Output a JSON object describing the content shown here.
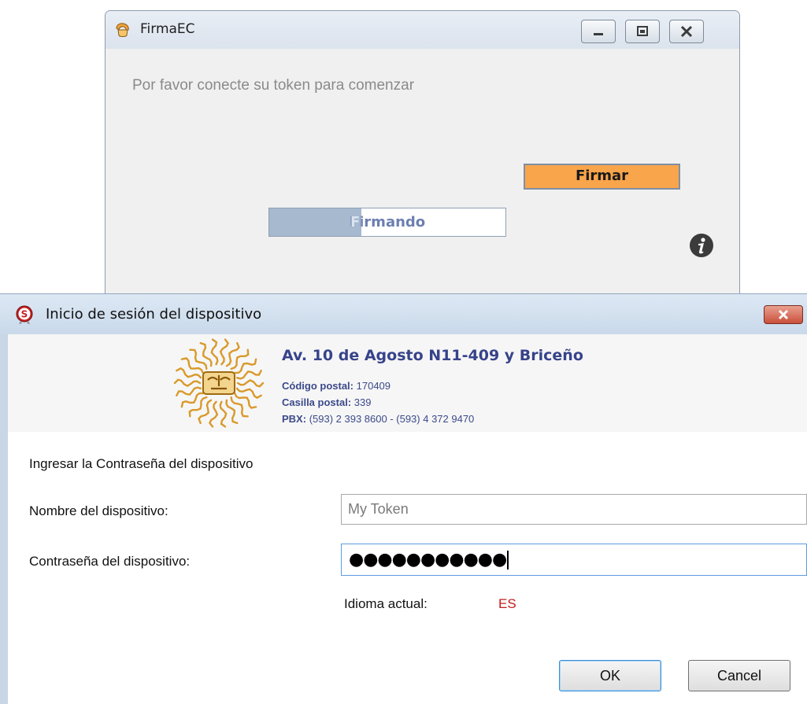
{
  "firma_window": {
    "title": "FirmaEC",
    "message": "Por favor conecte su token para comenzar",
    "firmar_label": "Firmar",
    "progress": {
      "label": "Firmando",
      "fraction": 0.39
    },
    "icons": {
      "app": "firmaec-app-icon",
      "info": "info-icon",
      "minimize": "minimize-icon",
      "maximize": "maximize-icon",
      "close": "close-icon"
    },
    "colors": {
      "firmar_button": "#f9a54b",
      "progress_fill": "#a7b9cf"
    }
  },
  "login_dialog": {
    "title": "Inicio de sesión del dispositivo",
    "banner": {
      "address": "Av. 10 de Agosto N11-409 y Briceño",
      "postal_label": "Código postal:",
      "postal_value": "170409",
      "casilla_label": "Casilla postal:",
      "casilla_value": "339",
      "pbx_label": "PBX:",
      "pbx_value": "(593) 2 393 8600 - (593) 4 372 9470"
    },
    "prompt": "Ingresar la Contraseña del dispositivo",
    "device_name_label": "Nombre del dispositivo:",
    "device_name_value": "My Token",
    "password_label": "Contraseña del dispositivo:",
    "password_value": "●●●●●●●●●●●",
    "language_label": "Idioma actual:",
    "language_value": "ES",
    "ok_label": "OK",
    "cancel_label": "Cancel",
    "colors": {
      "language_value": "#c41d1d",
      "close_button": "#c9503b",
      "address_text": "#37438a"
    }
  }
}
